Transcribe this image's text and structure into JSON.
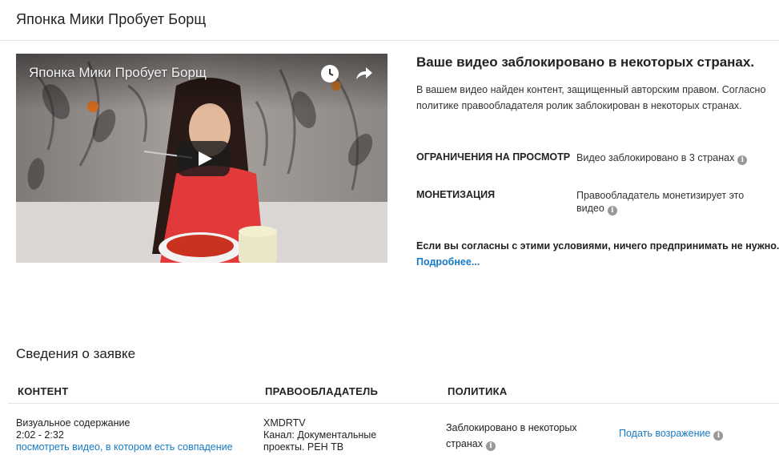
{
  "header": {
    "title": "Японка Мики Пробует Борщ"
  },
  "video": {
    "overlay_title": "Японка Мики Пробует Борщ",
    "icons": [
      "clock-icon",
      "share-icon",
      "play-icon"
    ]
  },
  "notice": {
    "heading": "Ваше видео заблокировано в некоторых странах.",
    "description": "В вашем видео найден контент, защищенный авторским правом. Согласно политике правообладателя ролик заблокирован в некоторых странах.",
    "rows": [
      {
        "label": "ОГРАНИЧЕНИЯ НА ПРОСМОТР",
        "value": "Видео заблокировано в 3 странах"
      },
      {
        "label": "МОНЕТИЗАЦИЯ",
        "value": "Правообладатель монетизирует это видео"
      }
    ],
    "agree_text": "Если вы согласны с этими условиями, ничего предпринимать не нужно.",
    "more_link": "Подробнее..."
  },
  "claim": {
    "title": "Сведения о заявке",
    "columns": [
      "КОНТЕНТ",
      "ПРАВООБЛАДАТЕЛЬ",
      "ПОЛИТИКА"
    ],
    "row": {
      "content_type": "Визуальное содержание",
      "time_range": "2:02 - 2:32",
      "match_link": "посмотреть видео, в котором есть совпадение",
      "owner_name": "XMDRTV",
      "owner_channel": "Канал: Документальные проекты. РЕН ТВ",
      "policy": "Заблокировано в некоторых странах",
      "dispute_link": "Подать возражение"
    }
  },
  "colors": {
    "link": "#167ac6",
    "divider": "#e3e3e3",
    "info_icon": "#999999"
  }
}
